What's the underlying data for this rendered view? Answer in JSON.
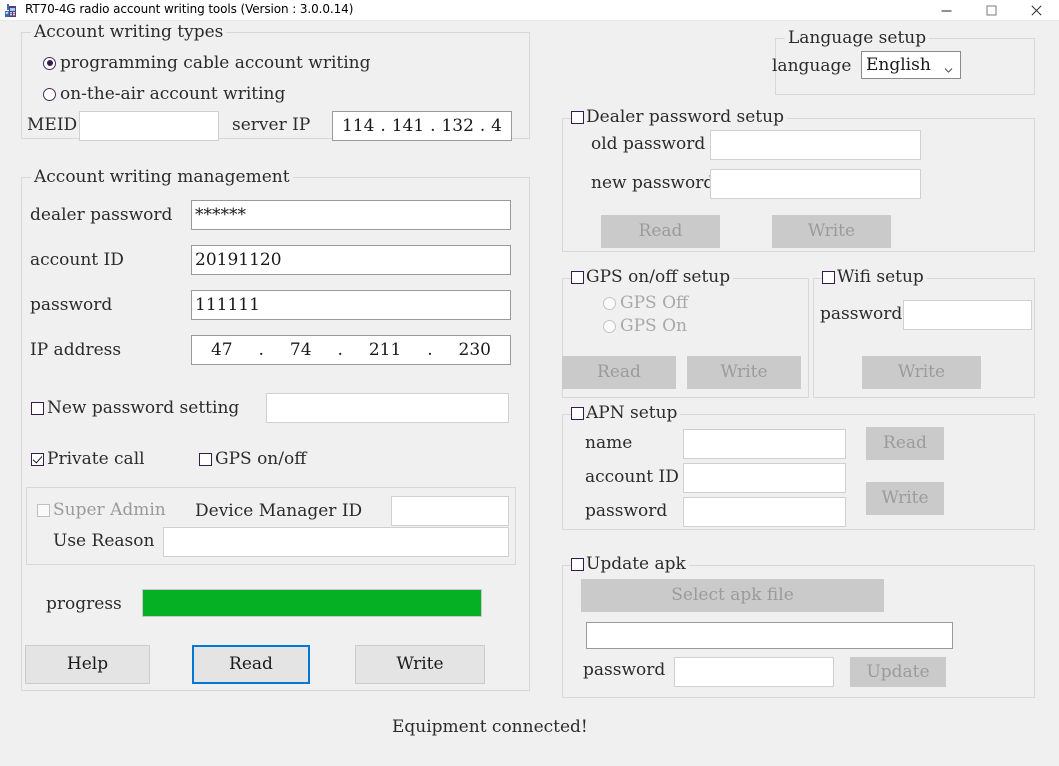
{
  "window": {
    "title": "RT70-4G radio account writing tools (Version : 3.0.0.14)",
    "icon": "radio-icon",
    "minimize": "—",
    "maximize": "☐",
    "close": "✕"
  },
  "account_writing_types": {
    "group_title": "Account writing types",
    "radios": [
      {
        "label": "programming cable account writing",
        "selected": true
      },
      {
        "label": "on-the-air account writing",
        "selected": false
      }
    ],
    "meid_label": "MEID",
    "meid_value": "",
    "server_ip_label": "server IP",
    "server_ip": [
      "114",
      "141",
      "132",
      "4"
    ]
  },
  "account_writing_management": {
    "group_title": "Account writing management",
    "dealer_password_label": "dealer password",
    "dealer_password_value": "******",
    "account_id_label": "account ID",
    "account_id_value": "20191120",
    "password_label": "password",
    "password_value": "111111",
    "ip_address_label": "IP address",
    "ip_address": [
      "47",
      "74",
      "211",
      "230"
    ],
    "new_password_setting_label": "New password setting",
    "new_password_setting_checked": false,
    "new_password_value": "",
    "private_call_label": "Private call",
    "private_call_checked": true,
    "gps_onoff_label": "GPS on/off",
    "gps_onoff_checked": false,
    "super_admin_label": "Super Admin",
    "super_admin_checked": false,
    "device_manager_id_label": "Device Manager ID",
    "device_manager_id_value": "",
    "use_reason_label": "Use Reason",
    "use_reason_value": "",
    "progress_label": "progress",
    "progress_percent": 100,
    "help_button": "Help",
    "read_button": "Read",
    "write_button": "Write"
  },
  "language_setup": {
    "group_title": "Language setup",
    "language_label": "language",
    "selected": "English",
    "options": [
      "English"
    ]
  },
  "dealer_password_setup": {
    "group_title": "Dealer password setup",
    "checked": false,
    "old_password_label": "old password",
    "old_password_value": "",
    "new_password_label": "new password",
    "new_password_value": "",
    "read_button": "Read",
    "write_button": "Write"
  },
  "gps_setup": {
    "group_title": "GPS on/off setup",
    "checked": false,
    "radios": [
      {
        "label": "GPS Off",
        "selected": false
      },
      {
        "label": "GPS On",
        "selected": false
      }
    ],
    "read_button": "Read",
    "write_button": "Write"
  },
  "wifi_setup": {
    "group_title": "Wifi setup",
    "checked": false,
    "password_label": "password",
    "password_value": "",
    "write_button": "Write"
  },
  "apn_setup": {
    "group_title": "APN setup",
    "checked": false,
    "name_label": "name",
    "name_value": "",
    "account_id_label": "account ID",
    "account_id_value": "",
    "password_label": "password",
    "password_value": "",
    "read_button": "Read",
    "write_button": "Write"
  },
  "update_apk": {
    "group_title": "Update apk",
    "checked": false,
    "select_file_button": "Select apk file",
    "file_path_value": "",
    "password_label": "password",
    "password_value": "",
    "update_button": "Update"
  },
  "status_bar": {
    "message": "Equipment connected!"
  },
  "colors": {
    "progress_green": "#06b025",
    "focus_blue": "#0078d7",
    "background": "#f0f0f0"
  }
}
